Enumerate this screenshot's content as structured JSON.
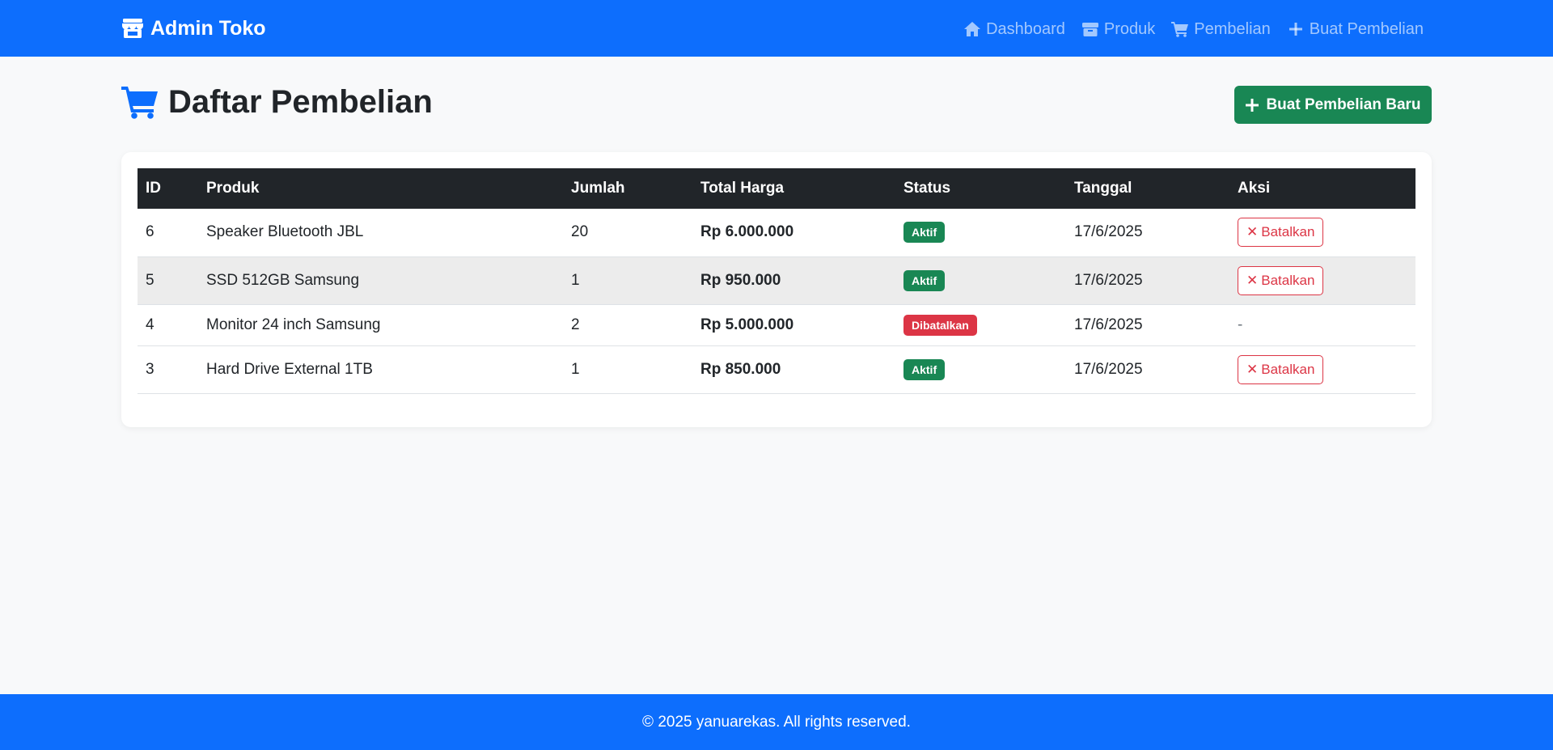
{
  "navbar": {
    "brand": "Admin Toko",
    "links": [
      {
        "label": "Dashboard",
        "icon": "home-icon"
      },
      {
        "label": "Produk",
        "icon": "box-icon"
      },
      {
        "label": "Pembelian",
        "icon": "cart-icon"
      },
      {
        "label": "Buat Pembelian",
        "icon": "plus-icon"
      }
    ]
  },
  "page": {
    "title": "Daftar Pembelian",
    "new_button": "Buat Pembelian Baru"
  },
  "table": {
    "headers": [
      "ID",
      "Produk",
      "Jumlah",
      "Total Harga",
      "Status",
      "Tanggal",
      "Aksi"
    ],
    "rows": [
      {
        "id": "6",
        "product": "Speaker Bluetooth JBL",
        "qty": "20",
        "total": "Rp 6.000.000",
        "status": "Aktif",
        "date": "17/6/2025",
        "action": "Batalkan"
      },
      {
        "id": "5",
        "product": "SSD 512GB Samsung",
        "qty": "1",
        "total": "Rp 950.000",
        "status": "Aktif",
        "date": "17/6/2025",
        "action": "Batalkan"
      },
      {
        "id": "4",
        "product": "Monitor 24 inch Samsung",
        "qty": "2",
        "total": "Rp 5.000.000",
        "status": "Dibatalkan",
        "date": "17/6/2025",
        "action": "-"
      },
      {
        "id": "3",
        "product": "Hard Drive External 1TB",
        "qty": "1",
        "total": "Rp 850.000",
        "status": "Aktif",
        "date": "17/6/2025",
        "action": "Batalkan"
      }
    ]
  },
  "footer": {
    "text": "© 2025 yanuarekas. All rights reserved."
  },
  "colors": {
    "primary": "#0d6efd",
    "success": "#198754",
    "danger": "#dc3545",
    "dark": "#212529"
  }
}
